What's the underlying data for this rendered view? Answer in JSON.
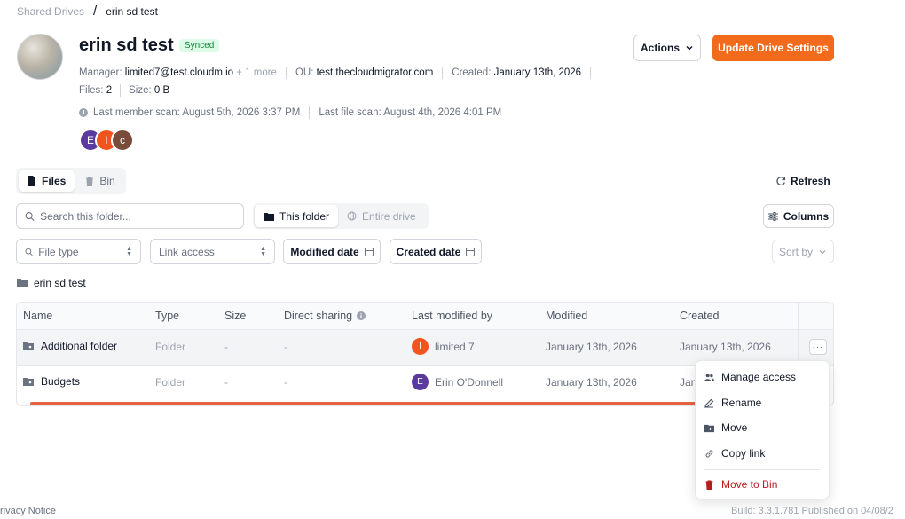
{
  "breadcrumb": {
    "root": "Shared Drives",
    "separator": "/",
    "current": "erin sd test"
  },
  "drive": {
    "title": "erin sd test",
    "status": "Synced",
    "manager_label": "Manager:",
    "manager": "limited7@test.cloudm.io",
    "manager_more": "+ 1 more",
    "ou_label": "OU:",
    "ou": "test.thecloudmigrator.com",
    "created_label": "Created:",
    "created": "January 13th, 2026",
    "files_label": "Files:",
    "files": "2",
    "size_label": "Size:",
    "size": "0 B",
    "member_scan": "Last member scan: August 5th, 2026 3:37 PM",
    "file_scan": "Last file scan: August 4th, 2026 4:01 PM",
    "members": [
      {
        "initial": "E",
        "color": "#5b3aa0"
      },
      {
        "initial": "l",
        "color": "#f2541d"
      },
      {
        "initial": "c",
        "color": "#7a4a3a"
      }
    ]
  },
  "header_actions": {
    "actions": "Actions",
    "update": "Update Drive Settings"
  },
  "tabs": {
    "files": "Files",
    "bin": "Bin"
  },
  "refresh": "Refresh",
  "search": {
    "placeholder": "Search this folder..."
  },
  "scope": {
    "this_folder": "This folder",
    "entire_drive": "Entire drive"
  },
  "columns_button": "Columns",
  "filters": {
    "file_type_placeholder": "File type",
    "link_access": "Link access",
    "modified_date": "Modified date",
    "created_date": "Created date",
    "sort_by": "Sort by"
  },
  "current_folder": "erin sd test",
  "table": {
    "headers": {
      "name": "Name",
      "type": "Type",
      "size": "Size",
      "sharing": "Direct sharing",
      "modified_by": "Last modified by",
      "modified": "Modified",
      "created": "Created"
    },
    "rows": [
      {
        "name": "Additional folder",
        "type": "Folder",
        "size": "-",
        "sharing": "-",
        "user_initial": "l",
        "user_color": "#f2541d",
        "user": "limited 7",
        "modified": "January 13th, 2026",
        "created": "January 13th, 2026"
      },
      {
        "name": "Budgets",
        "type": "Folder",
        "size": "-",
        "sharing": "-",
        "user_initial": "E",
        "user_color": "#5b3aa0",
        "user": "Erin O'Donnell",
        "modified": "January 13th, 2026",
        "created": "Jan"
      }
    ],
    "row_menu_label": "···"
  },
  "context_menu": {
    "manage_access": "Manage access",
    "rename": "Rename",
    "move": "Move",
    "copy_link": "Copy link",
    "move_to_bin": "Move to Bin"
  },
  "footer": {
    "privacy": "rivacy Notice",
    "build": "Build: 3.3.1.781 Published on 04/08/2"
  },
  "colors": {
    "accent": "#f26b1d",
    "danger": "#b91c1c",
    "synced_bg": "#dcfce7"
  }
}
